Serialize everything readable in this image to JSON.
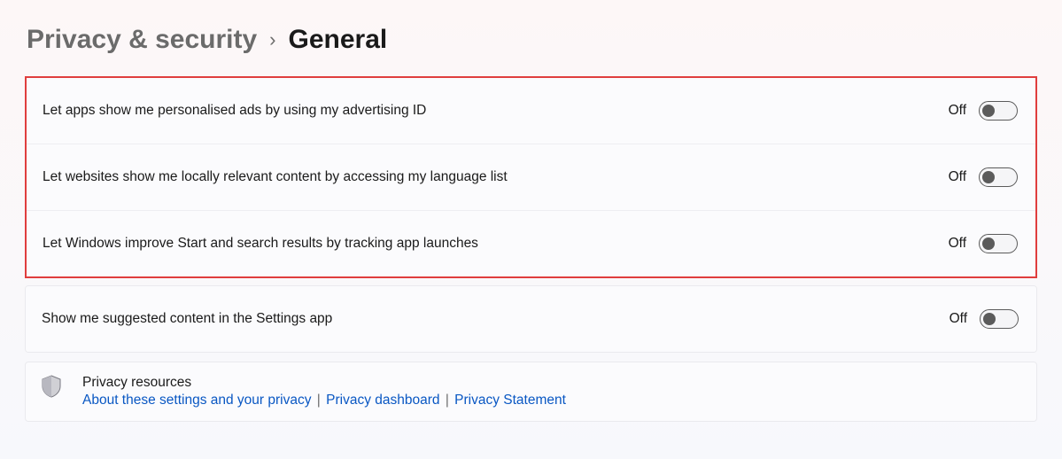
{
  "breadcrumb": {
    "parent": "Privacy & security",
    "separator": "›",
    "current": "General"
  },
  "settings": [
    {
      "label": "Let apps show me personalised ads by using my advertising ID",
      "state": "Off"
    },
    {
      "label": "Let websites show me locally relevant content by accessing my language list",
      "state": "Off"
    },
    {
      "label": "Let Windows improve Start and search results by tracking app launches",
      "state": "Off"
    }
  ],
  "extra_setting": {
    "label": "Show me suggested content in the Settings app",
    "state": "Off"
  },
  "resources": {
    "title": "Privacy resources",
    "links": [
      "About these settings and your privacy",
      "Privacy dashboard",
      "Privacy Statement"
    ],
    "separator": "|"
  }
}
